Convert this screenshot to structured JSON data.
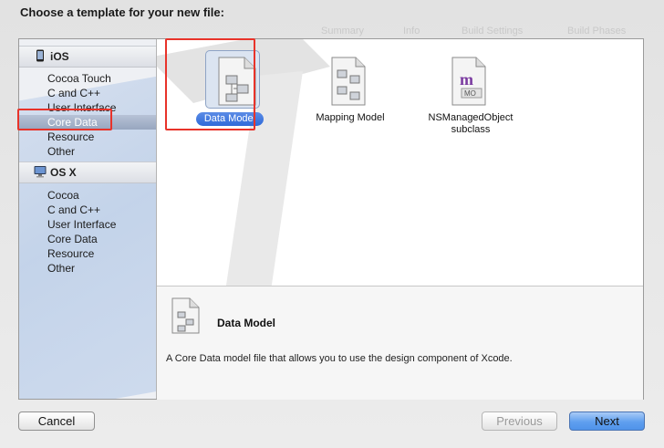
{
  "sheet": {
    "title": "Choose a template for your new file:"
  },
  "background_tabs": [
    "Summary",
    "Info",
    "Build Settings",
    "Build Phases"
  ],
  "sidebar": {
    "groups": [
      {
        "label": "iOS",
        "icon": "iphone-icon",
        "items": [
          {
            "label": "Cocoa Touch"
          },
          {
            "label": "C and C++"
          },
          {
            "label": "User Interface"
          },
          {
            "label": "Core Data",
            "selected": true
          },
          {
            "label": "Resource"
          },
          {
            "label": "Other"
          }
        ]
      },
      {
        "label": "OS X",
        "icon": "mac-icon",
        "items": [
          {
            "label": "Cocoa"
          },
          {
            "label": "C and C++"
          },
          {
            "label": "User Interface"
          },
          {
            "label": "Core Data"
          },
          {
            "label": "Resource"
          },
          {
            "label": "Other"
          }
        ]
      }
    ]
  },
  "templates": [
    {
      "label": "Data Model",
      "icon": "data-model-file-icon",
      "selected": true
    },
    {
      "label": "Mapping Model",
      "icon": "mapping-model-file-icon"
    },
    {
      "label": "NSManagedObject\nsubclass",
      "icon": "managed-object-file-icon"
    }
  ],
  "description": {
    "title": "Data Model",
    "text": "A Core Data model file that allows you to use the design component of Xcode."
  },
  "buttons": {
    "cancel": "Cancel",
    "previous": "Previous",
    "next": "Next"
  },
  "colors": {
    "highlight": "#e8332a",
    "selection": "#2f6ad9",
    "primary_button": "#5f9fef"
  }
}
